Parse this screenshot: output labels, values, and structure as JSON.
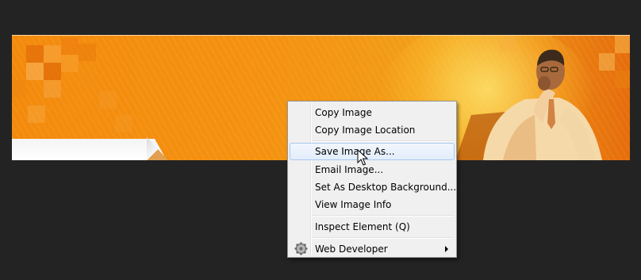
{
  "banner": {
    "description_icon": "person-on-phone-photo",
    "colors": {
      "orange": "#f38a0c",
      "dark_orange": "#e66d0b",
      "page_bg": "#232323"
    }
  },
  "context_menu": {
    "items": [
      {
        "label": "Copy Image",
        "icon": null,
        "submenu": false,
        "highlighted": false
      },
      {
        "label": "Copy Image Location",
        "icon": null,
        "submenu": false,
        "highlighted": false
      },
      {
        "label": "Save Image As...",
        "icon": null,
        "submenu": false,
        "highlighted": true
      },
      {
        "label": "Email Image...",
        "icon": null,
        "submenu": false,
        "highlighted": false
      },
      {
        "label": "Set As Desktop Background...",
        "icon": null,
        "submenu": false,
        "highlighted": false
      },
      {
        "label": "View Image Info",
        "icon": null,
        "submenu": false,
        "highlighted": false
      },
      {
        "label": "Inspect Element (Q)",
        "icon": null,
        "submenu": false,
        "highlighted": false
      },
      {
        "label": "Web Developer",
        "icon": "gear-icon",
        "submenu": true,
        "highlighted": false
      }
    ],
    "highlight_colors": {
      "bg_top": "#f1f6fd",
      "bg_bottom": "#e3edfb",
      "border": "#a8c8ed"
    }
  }
}
